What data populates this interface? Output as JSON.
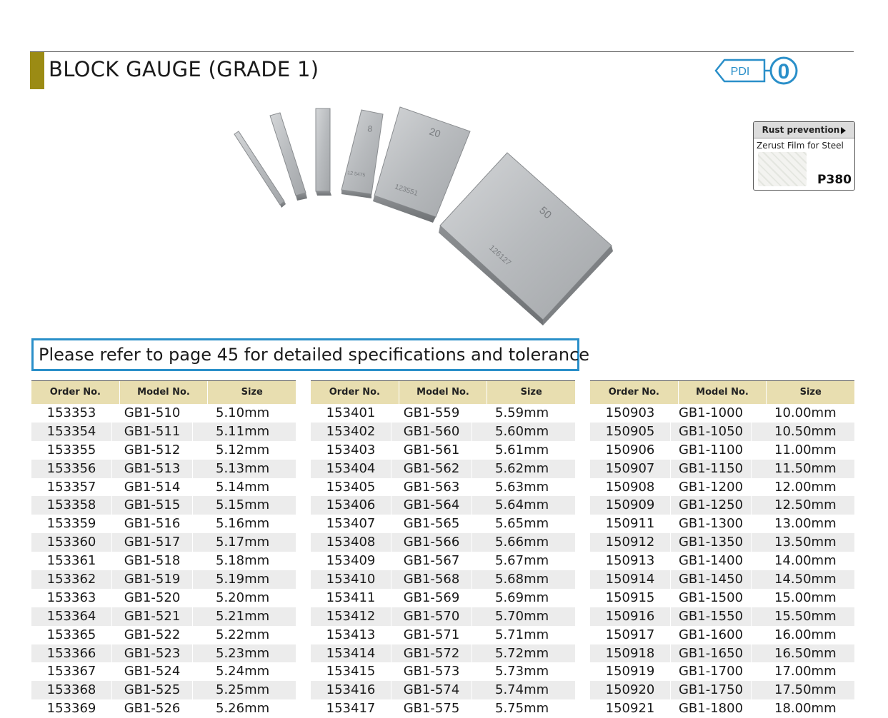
{
  "header": {
    "title": "BLOCK GAUGE (GRADE 1)"
  },
  "brand": {
    "logo_text": "PDI",
    "number_mark": "0",
    "accent_color": "#2a8fc9",
    "title_bar_color": "#9b8b14"
  },
  "rust_prevention": {
    "label": "Rust prevention",
    "product": "Zerust Film for Steel",
    "code": "P380"
  },
  "image": {
    "block_labels": [
      "8",
      "20",
      "50"
    ],
    "serials": [
      "12 5475",
      "123551",
      "126127"
    ]
  },
  "note": "Please refer to page 45 for detailed specifications and tolerance",
  "table_headers": [
    "Order No.",
    "Model No.",
    "Size"
  ],
  "tables": [
    [
      [
        "153353",
        "GB1-510",
        "5.10mm"
      ],
      [
        "153354",
        "GB1-511",
        "5.11mm"
      ],
      [
        "153355",
        "GB1-512",
        "5.12mm"
      ],
      [
        "153356",
        "GB1-513",
        "5.13mm"
      ],
      [
        "153357",
        "GB1-514",
        "5.14mm"
      ],
      [
        "153358",
        "GB1-515",
        "5.15mm"
      ],
      [
        "153359",
        "GB1-516",
        "5.16mm"
      ],
      [
        "153360",
        "GB1-517",
        "5.17mm"
      ],
      [
        "153361",
        "GB1-518",
        "5.18mm"
      ],
      [
        "153362",
        "GB1-519",
        "5.19mm"
      ],
      [
        "153363",
        "GB1-520",
        "5.20mm"
      ],
      [
        "153364",
        "GB1-521",
        "5.21mm"
      ],
      [
        "153365",
        "GB1-522",
        "5.22mm"
      ],
      [
        "153366",
        "GB1-523",
        "5.23mm"
      ],
      [
        "153367",
        "GB1-524",
        "5.24mm"
      ],
      [
        "153368",
        "GB1-525",
        "5.25mm"
      ],
      [
        "153369",
        "GB1-526",
        "5.26mm"
      ]
    ],
    [
      [
        "153401",
        "GB1-559",
        "5.59mm"
      ],
      [
        "153402",
        "GB1-560",
        "5.60mm"
      ],
      [
        "153403",
        "GB1-561",
        "5.61mm"
      ],
      [
        "153404",
        "GB1-562",
        "5.62mm"
      ],
      [
        "153405",
        "GB1-563",
        "5.63mm"
      ],
      [
        "153406",
        "GB1-564",
        "5.64mm"
      ],
      [
        "153407",
        "GB1-565",
        "5.65mm"
      ],
      [
        "153408",
        "GB1-566",
        "5.66mm"
      ],
      [
        "153409",
        "GB1-567",
        "5.67mm"
      ],
      [
        "153410",
        "GB1-568",
        "5.68mm"
      ],
      [
        "153411",
        "GB1-569",
        "5.69mm"
      ],
      [
        "153412",
        "GB1-570",
        "5.70mm"
      ],
      [
        "153413",
        "GB1-571",
        "5.71mm"
      ],
      [
        "153414",
        "GB1-572",
        "5.72mm"
      ],
      [
        "153415",
        "GB1-573",
        "5.73mm"
      ],
      [
        "153416",
        "GB1-574",
        "5.74mm"
      ],
      [
        "153417",
        "GB1-575",
        "5.75mm"
      ]
    ],
    [
      [
        "150903",
        "GB1-1000",
        "10.00mm"
      ],
      [
        "150905",
        "GB1-1050",
        "10.50mm"
      ],
      [
        "150906",
        "GB1-1100",
        "11.00mm"
      ],
      [
        "150907",
        "GB1-1150",
        "11.50mm"
      ],
      [
        "150908",
        "GB1-1200",
        "12.00mm"
      ],
      [
        "150909",
        "GB1-1250",
        "12.50mm"
      ],
      [
        "150911",
        "GB1-1300",
        "13.00mm"
      ],
      [
        "150912",
        "GB1-1350",
        "13.50mm"
      ],
      [
        "150913",
        "GB1-1400",
        "14.00mm"
      ],
      [
        "150914",
        "GB1-1450",
        "14.50mm"
      ],
      [
        "150915",
        "GB1-1500",
        "15.00mm"
      ],
      [
        "150916",
        "GB1-1550",
        "15.50mm"
      ],
      [
        "150917",
        "GB1-1600",
        "16.00mm"
      ],
      [
        "150918",
        "GB1-1650",
        "16.50mm"
      ],
      [
        "150919",
        "GB1-1700",
        "17.00mm"
      ],
      [
        "150920",
        "GB1-1750",
        "17.50mm"
      ],
      [
        "150921",
        "GB1-1800",
        "18.00mm"
      ]
    ]
  ]
}
